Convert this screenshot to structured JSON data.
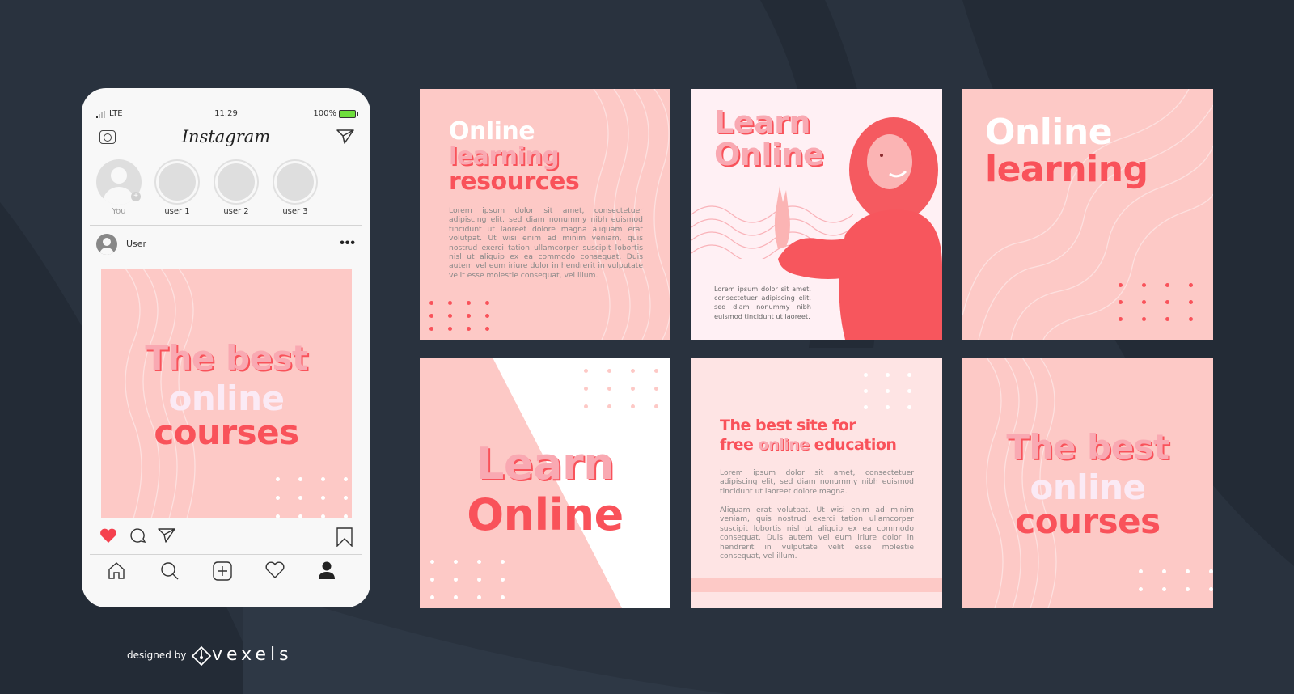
{
  "phone": {
    "status": {
      "network": "LTE",
      "time": "11:29",
      "battery": "100%"
    },
    "app_title": "Instagram",
    "stories": [
      {
        "label": "You"
      },
      {
        "label": "user 1"
      },
      {
        "label": "user 2"
      },
      {
        "label": "user 3"
      }
    ],
    "post": {
      "username": "User",
      "more": "•••",
      "headline": [
        "The best",
        "online",
        "courses"
      ],
      "liked": true
    },
    "icons": {
      "header": [
        "camera-icon",
        "send-icon"
      ],
      "actions": [
        "heart-filled-icon",
        "comment-icon",
        "share-icon",
        "bookmark-icon"
      ],
      "nav": [
        "home-icon",
        "search-icon",
        "add-icon",
        "activity-heart-icon",
        "profile-icon"
      ]
    }
  },
  "cards": [
    {
      "id": "online-learning-resources",
      "title": [
        "Online",
        "learning",
        "resources"
      ],
      "body": "Lorem ipsum dolor sit amet, consectetuer adipiscing elit, sed diam nonummy nibh euismod tincidunt ut laoreet dolore magna aliquam erat volutpat. Ut wisi enim ad minim veniam, quis nostrud exerci tation ullamcorper suscipit lobortis nisl ut aliquip ex ea commodo consequat. Duis autem vel eum iriure dolor in hendrerit in vulputate velit esse molestie consequat, vel illum."
    },
    {
      "id": "learn-online-photo",
      "title": [
        "Learn",
        "Online"
      ],
      "body": "Lorem ipsum dolor sit amet, consectetuer adipiscing elit, sed diam nonummy nibh euismod tincidunt ut laoreet."
    },
    {
      "id": "online-learning",
      "title": [
        "Online",
        "learning"
      ]
    },
    {
      "id": "learn-online",
      "title": [
        "Learn",
        "Online"
      ]
    },
    {
      "id": "best-site",
      "title_line1": "The best site for",
      "title_line2_pre": "free ",
      "title_line2_highlight": "online",
      "title_line2_post": " education",
      "body1": "Lorem ipsum dolor sit amet, consectetuer adipiscing elit, sed diam nonummy nibh euismod tincidunt ut laoreet dolore magna.",
      "body2": "Aliquam erat volutpat. Ut wisi enim ad minim veniam, quis nostrud exerci tation ullamcorper suscipit lobortis nisl ut aliquip ex ea commodo consequat. Duis autem vel eum iriure dolor in hendrerit in vulputate velit esse molestie consequat, vel illum."
    },
    {
      "id": "best-online-courses",
      "title": [
        "The best",
        "online",
        "courses"
      ]
    }
  ],
  "colors": {
    "background": "#29323e",
    "pink": "#fdc9c6",
    "coral": "#f9525a",
    "soft_pink": "#f9a9b2"
  },
  "footer": {
    "designed_by": "designed by",
    "brand": "vexels"
  }
}
